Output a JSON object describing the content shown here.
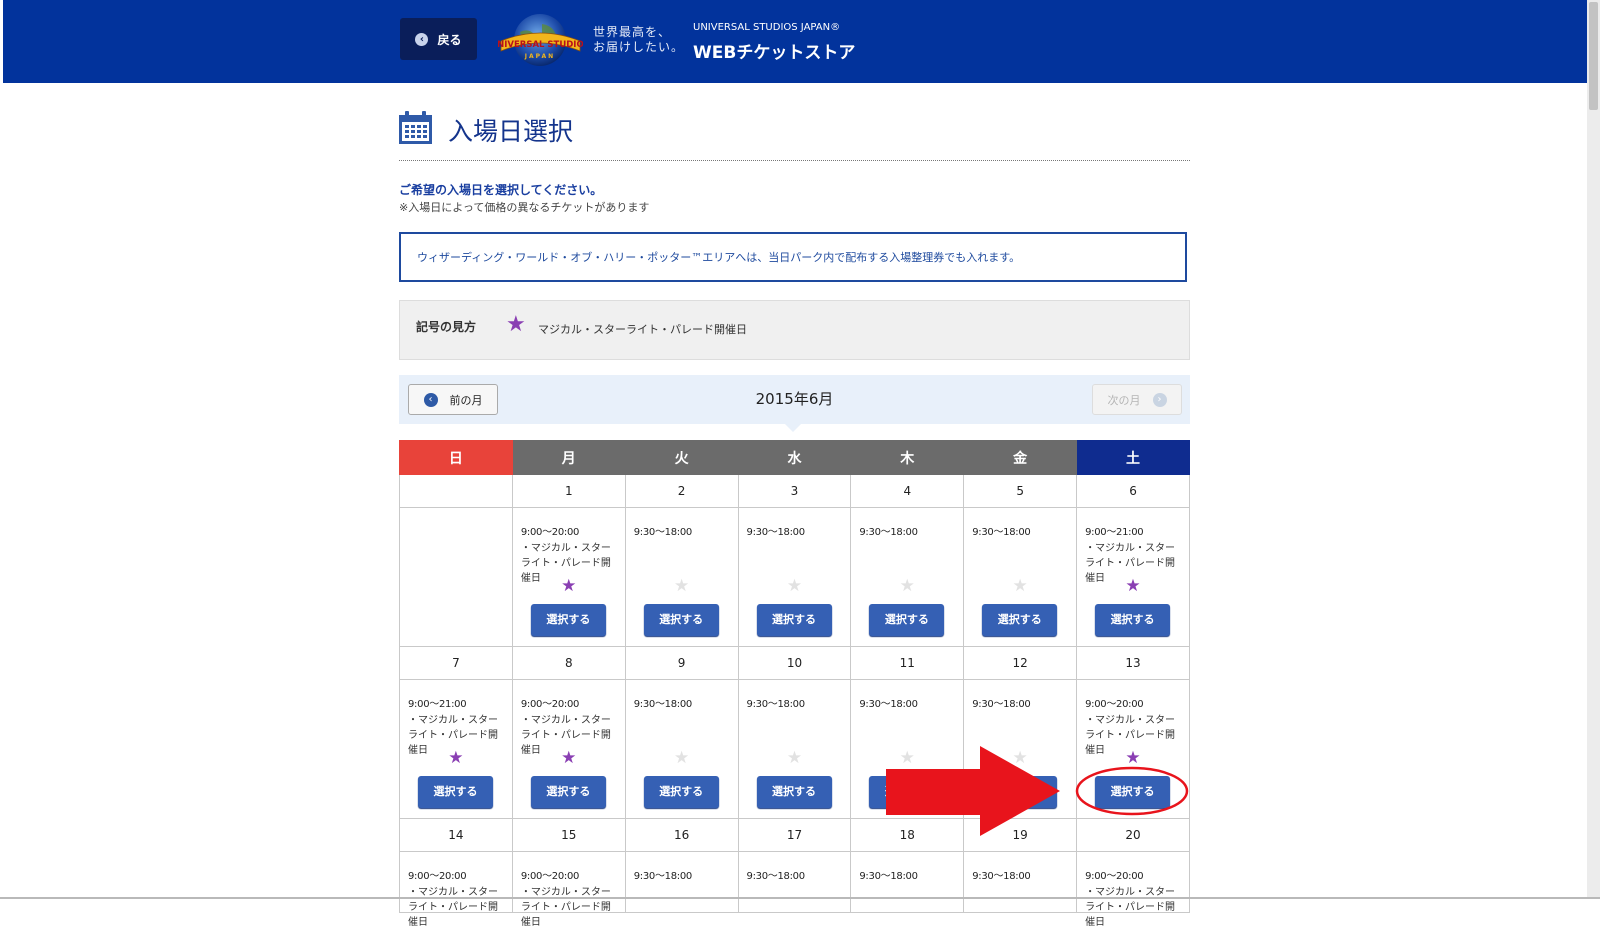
{
  "header": {
    "back_label": "戻る",
    "tagline_line1": "世界最高を、",
    "tagline_line2": "お届けしたい。",
    "usj_label": "UNIVERSAL STUDIOS JAPAN®",
    "store_title": "WEBチケットストア",
    "logo_text_top": "UNIVERSAL STUDIOS",
    "logo_text_bottom": "JAPAN",
    "bg_color": "#02339c"
  },
  "page": {
    "title": "入場日選択",
    "instruction": "ご希望の入場日を選択してください。",
    "note": "※入場日によって価格の異なるチケットがあります",
    "notice": "ウィザーディング・ワールド・オブ・ハリー・ポッター™エリアへは、当日パーク内で配布する入場整理券でも入れます。"
  },
  "legend": {
    "title": "記号の見方",
    "item_label": "マジカル・スターライト・パレード開催日",
    "icon": "star-icon",
    "star_color": "#8a3fb3"
  },
  "month_nav": {
    "prev_label": "前の月",
    "next_label": "次の月",
    "current": "2015年6月"
  },
  "weekdays": [
    "日",
    "月",
    "火",
    "水",
    "木",
    "金",
    "土"
  ],
  "button_label": "選択する",
  "weeks": [
    [
      {
        "date": "",
        "empty": true
      },
      {
        "date": "1",
        "hours": "9:00〜20:00",
        "note": "・マジカル・スターライト・パレード開催日",
        "star": true
      },
      {
        "date": "2",
        "hours": "9:30〜18:00",
        "note": "",
        "star": false
      },
      {
        "date": "3",
        "hours": "9:30〜18:00",
        "note": "",
        "star": false
      },
      {
        "date": "4",
        "hours": "9:30〜18:00",
        "note": "",
        "star": false
      },
      {
        "date": "5",
        "hours": "9:30〜18:00",
        "note": "",
        "star": false
      },
      {
        "date": "6",
        "hours": "9:00〜21:00",
        "note": "・マジカル・スターライト・パレード開催日",
        "star": true
      }
    ],
    [
      {
        "date": "7",
        "hours": "9:00〜21:00",
        "note": "・マジカル・スターライト・パレード開催日",
        "star": true
      },
      {
        "date": "8",
        "hours": "9:00〜20:00",
        "note": "・マジカル・スターライト・パレード開催日",
        "star": true
      },
      {
        "date": "9",
        "hours": "9:30〜18:00",
        "note": "",
        "star": false
      },
      {
        "date": "10",
        "hours": "9:30〜18:00",
        "note": "",
        "star": false
      },
      {
        "date": "11",
        "hours": "9:30〜18:00",
        "note": "",
        "star": false
      },
      {
        "date": "12",
        "hours": "9:30〜18:00",
        "note": "",
        "star": false
      },
      {
        "date": "13",
        "hours": "9:00〜20:00",
        "note": "・マジカル・スターライト・パレード開催日",
        "star": true
      }
    ],
    [
      {
        "date": "14",
        "hours": "9:00〜20:00",
        "note": "・マジカル・スターライト・パレード開催日",
        "star": true
      },
      {
        "date": "15",
        "hours": "9:00〜20:00",
        "note": "・マジカル・スターライト・パレード開催日",
        "star": true
      },
      {
        "date": "16",
        "hours": "9:30〜18:00",
        "note": "",
        "star": false
      },
      {
        "date": "17",
        "hours": "9:30〜18:00",
        "note": "",
        "star": false
      },
      {
        "date": "18",
        "hours": "9:30〜18:00",
        "note": "",
        "star": false
      },
      {
        "date": "19",
        "hours": "9:30〜18:00",
        "note": "",
        "star": false
      },
      {
        "date": "20",
        "hours": "9:00〜20:00",
        "note": "・マジカル・スターライト・パレード開催日",
        "star": true
      }
    ]
  ],
  "annotation": {
    "arrow_color": "#e8141c",
    "circle_color": "#e8141c",
    "highlighted_date": "13"
  }
}
